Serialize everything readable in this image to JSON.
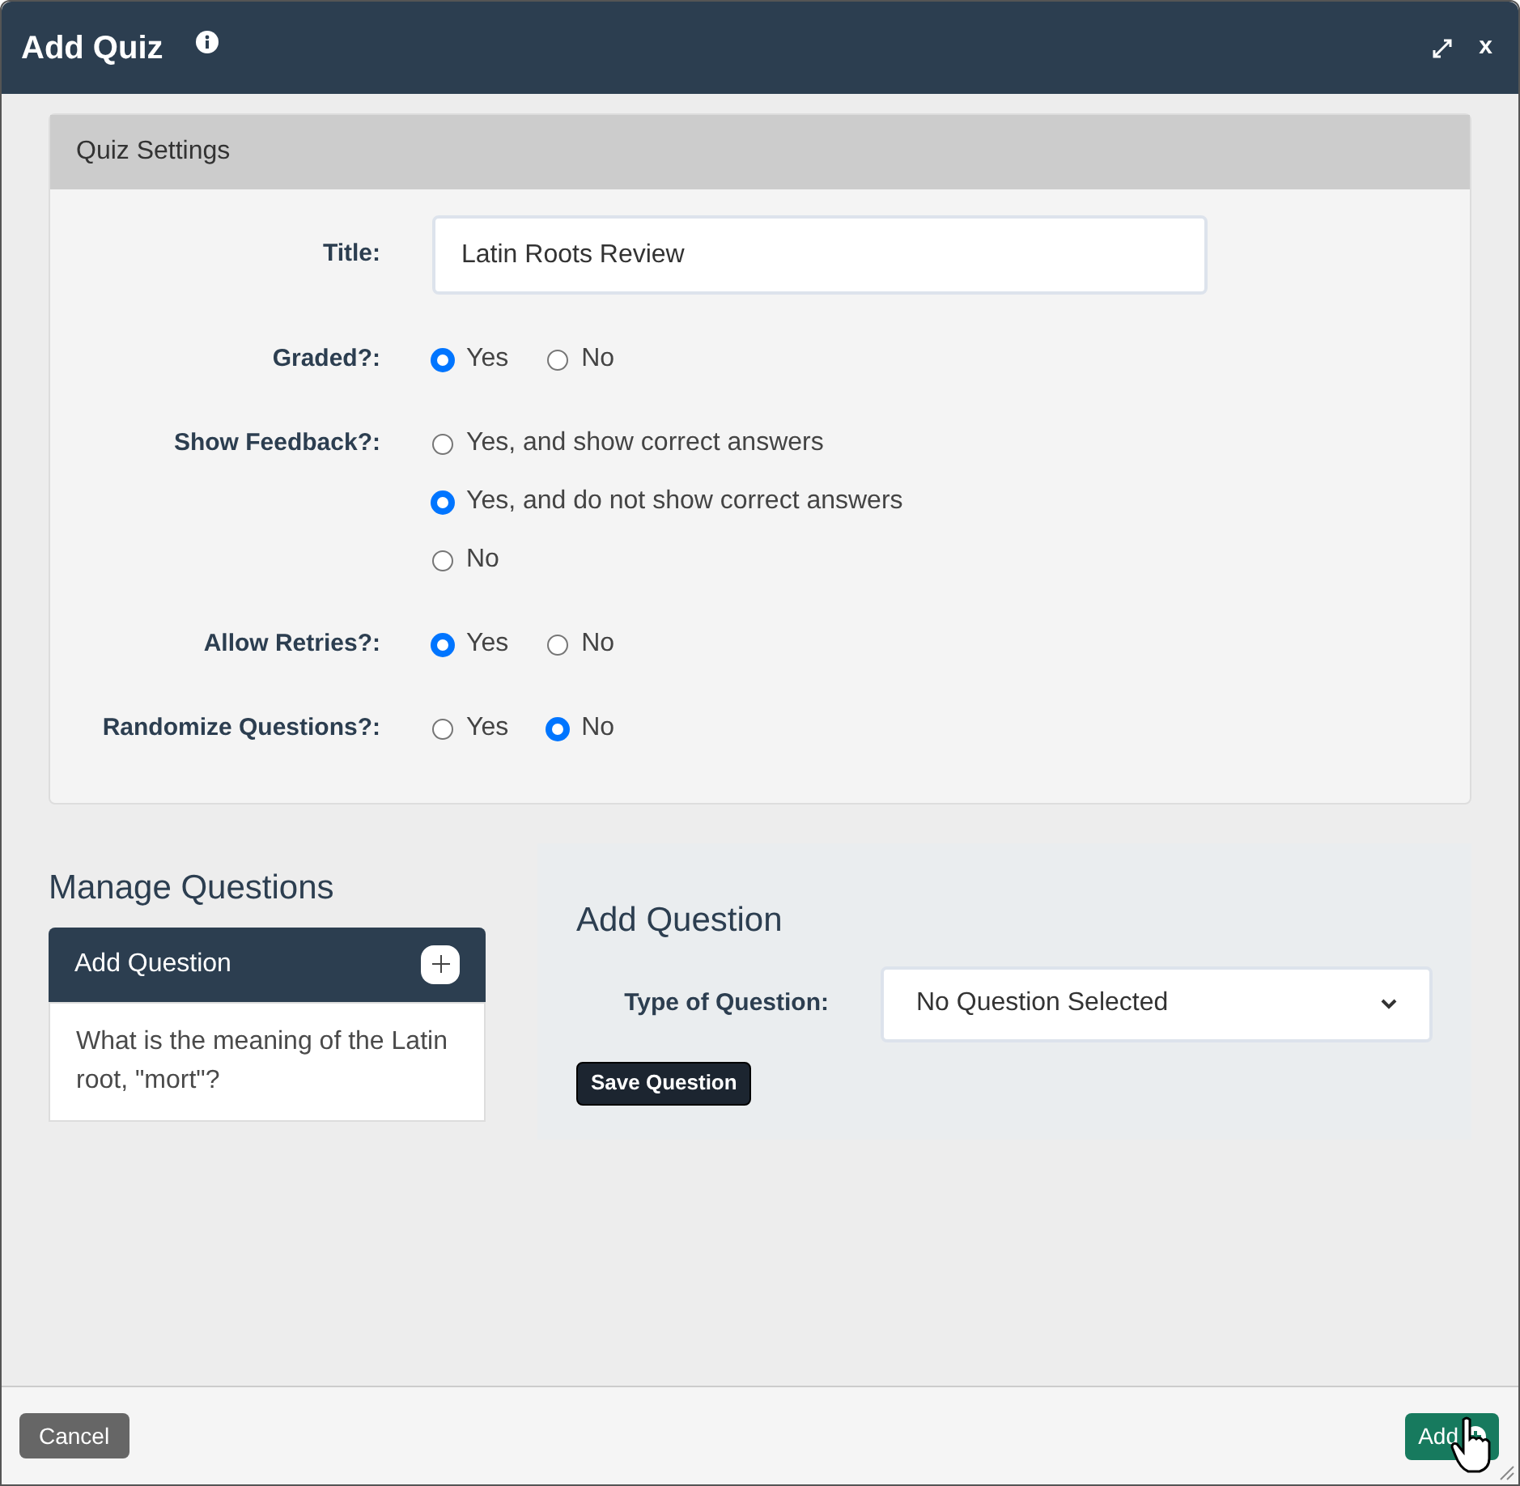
{
  "window": {
    "title": "Add Quiz",
    "close_label": "x"
  },
  "quiz_settings": {
    "heading": "Quiz Settings",
    "fields": [
      {
        "kind": "text",
        "label": "Title:",
        "value": "Latin Roots Review"
      },
      {
        "kind": "radio-row",
        "label": "Graded?:",
        "options": [
          {
            "label": "Yes",
            "selected": true
          },
          {
            "label": "No",
            "selected": false
          }
        ]
      },
      {
        "kind": "radio-column",
        "label": "Show Feedback?:",
        "options": [
          {
            "label": "Yes, and show correct answers",
            "selected": false
          },
          {
            "label": "Yes, and do not show correct answers",
            "selected": true
          },
          {
            "label": "No",
            "selected": false
          }
        ]
      },
      {
        "kind": "radio-row",
        "label": "Allow Retries?:",
        "options": [
          {
            "label": "Yes",
            "selected": true
          },
          {
            "label": "No",
            "selected": false
          }
        ]
      },
      {
        "kind": "radio-row",
        "label": "Randomize Questions?:",
        "options": [
          {
            "label": "Yes",
            "selected": false
          },
          {
            "label": "No",
            "selected": true
          }
        ]
      }
    ]
  },
  "manage_questions": {
    "heading": "Manage Questions",
    "list_header": "Add Question",
    "questions": [
      "What is the meaning of the Latin root, \"mort\"?"
    ]
  },
  "add_question": {
    "heading": "Add Question",
    "type_label": "Type of Question:",
    "type_value": "No Question Selected",
    "save_button": "Save Question"
  },
  "footer": {
    "cancel_button": "Cancel",
    "add_button": "Add"
  }
}
